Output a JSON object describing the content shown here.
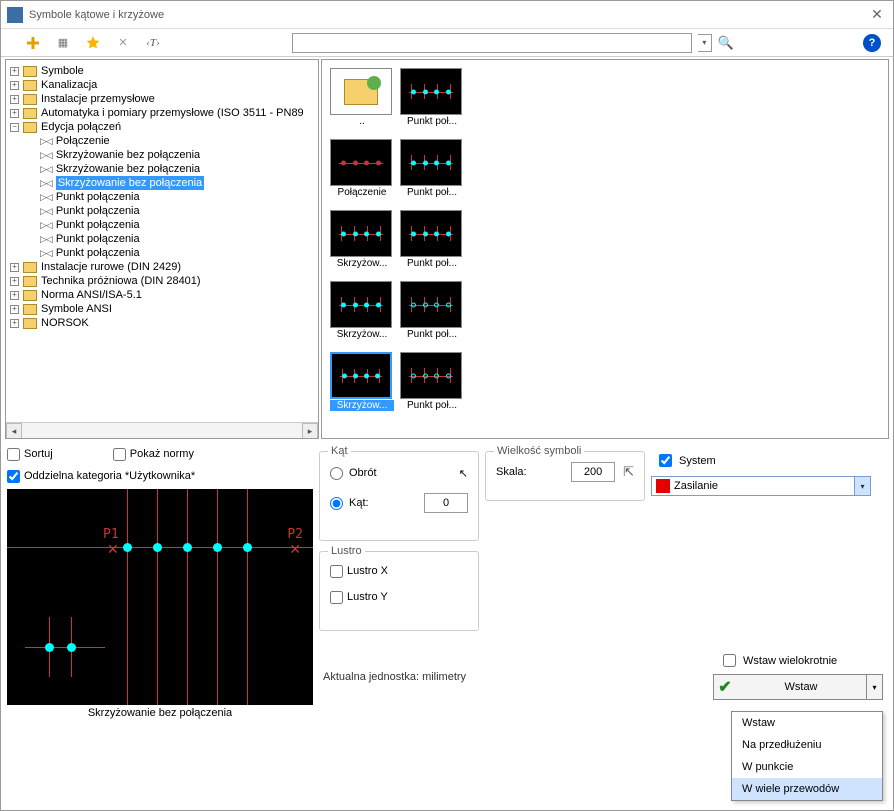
{
  "window": {
    "title": "Symbole kątowe i krzyżowe"
  },
  "toolbar": {
    "icons": [
      "add",
      "grid",
      "favorite",
      "delete",
      "text-style"
    ]
  },
  "search": {
    "value": "",
    "placeholder": ""
  },
  "tree": {
    "top": [
      {
        "label": "Symbole"
      },
      {
        "label": "Kanalizacja"
      },
      {
        "label": "Instalacje przemysłowe"
      },
      {
        "label": "Automatyka i pomiary przemysłowe (ISO 3511 - PN89"
      }
    ],
    "expanded": {
      "label": "Edycja połączeń"
    },
    "children": [
      {
        "label": "Połączenie"
      },
      {
        "label": "Skrzyżowanie bez połączenia"
      },
      {
        "label": "Skrzyżowanie bez połączenia"
      },
      {
        "label": "Skrzyżowanie bez połączenia",
        "selected": true
      },
      {
        "label": "Punkt połączenia"
      },
      {
        "label": "Punkt połączenia"
      },
      {
        "label": "Punkt połączenia"
      },
      {
        "label": "Punkt połączenia"
      },
      {
        "label": "Punkt połączenia"
      }
    ],
    "bottom": [
      {
        "label": "Instalacje rurowe (DIN 2429)"
      },
      {
        "label": "Technika próżniowa (DIN 28401)"
      },
      {
        "label": "Norma ANSI/ISA-5.1"
      },
      {
        "label": "Symbole ANSI"
      },
      {
        "label": "NORSOK"
      }
    ]
  },
  "thumbs": [
    {
      "cap": "..",
      "type": "folder"
    },
    {
      "cap": "Punkt poł...",
      "type": "pt"
    },
    {
      "cap": "Połączenie",
      "type": "conn"
    },
    {
      "cap": "Punkt poł...",
      "type": "pt"
    },
    {
      "cap": "Skrzyżow...",
      "type": "cross"
    },
    {
      "cap": "Punkt poł...",
      "type": "pt"
    },
    {
      "cap": "Skrzyżow...",
      "type": "cross"
    },
    {
      "cap": "Punkt poł...",
      "type": "pt-open"
    },
    {
      "cap": "Skrzyżow...",
      "type": "cross-sel",
      "selected": true
    },
    {
      "cap": "Punkt poł...",
      "type": "pt-open"
    }
  ],
  "options": {
    "sort_label": "Sortuj",
    "norms_label": "Pokaż normy",
    "usercat_label": "Oddzielna kategoria *Użytkownika*",
    "usercat_checked": true
  },
  "preview_caption": "Skrzyżowanie bez połączenia",
  "angle": {
    "legend": "Kąt",
    "rot_label": "Obrót",
    "ang_label": "Kąt:",
    "value": "0",
    "selected": "ang"
  },
  "mirror": {
    "legend": "Lustro",
    "x_label": "Lustro X",
    "y_label": "Lustro Y"
  },
  "size": {
    "legend": "Wielkość symboli",
    "scale_label": "Skala:",
    "value": "200"
  },
  "system": {
    "checkbox_label": "System",
    "checked": true,
    "value": "Zasilanie",
    "color": "#e40000"
  },
  "units_label": "Aktualna jednostka: milimetry",
  "insert": {
    "multi_label": "Wstaw wielokrotnie",
    "button_label": "Wstaw",
    "menu": [
      "Wstaw",
      "Na przedłużeniu",
      "W punkcie",
      "W wiele przewodów"
    ],
    "highlighted": 3
  },
  "preview_markers": {
    "p1": "P1",
    "p2": "P2"
  }
}
